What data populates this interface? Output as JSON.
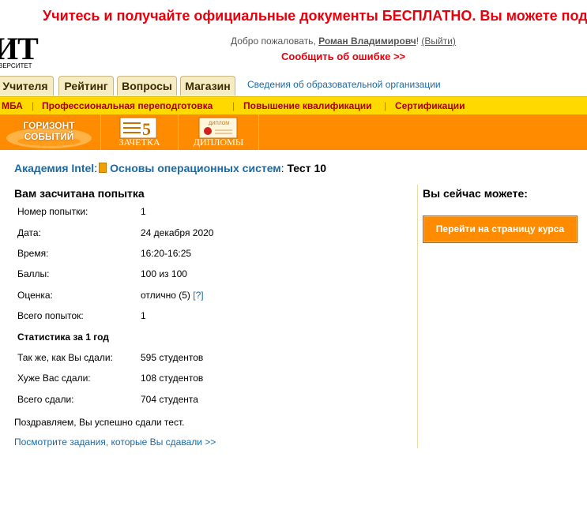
{
  "banner": {
    "text": "Учитесь и получайте официальные документы БЕСПЛАТНО. Вы можете поддержать н"
  },
  "logo": {
    "big": "ИТ",
    "small": "ВЕРСИТЕТ"
  },
  "header": {
    "welcome_prefix": "Добро пожаловать, ",
    "user_name": "Роман Владимировч",
    "after_name": "! ",
    "logout": "(Выйти)",
    "report_error": "Сообщить об ошибке >>",
    "org_info_link": "Сведения об образовательной организации"
  },
  "tabs": [
    "Учителя",
    "Рейтинг",
    "Вопросы",
    "Магазин"
  ],
  "yellow_nav": [
    "МБА",
    "Профессиональная переподготовка",
    "Повышение квалификации",
    "Сертификации"
  ],
  "orange_nav": {
    "horizon_line1": "ГОРИЗОНТ",
    "horizon_line2": "СОБЫТИЙ",
    "gradebook_icon_digit": "5",
    "gradebook": "ЗАЧЕТКА",
    "diploma_icon_text": "ДИПЛОМ",
    "diplomas": "ДИПЛОМЫ"
  },
  "breadcrumb": {
    "academy": "Академия Intel",
    "course": "Основы операционных систем",
    "current": "Тест 10"
  },
  "attempt": {
    "title": "Вам засчитана попытка",
    "rows": [
      {
        "label": "Номер попытки:",
        "value": "1"
      },
      {
        "label": "Дата:",
        "value": "24 декабря 2020"
      },
      {
        "label": "Время:",
        "value": "16:20-16:25"
      },
      {
        "label": "Баллы:",
        "value": "100 из 100"
      },
      {
        "label": "Оценка:",
        "value": "отлично (5)",
        "help": "[?]"
      },
      {
        "label": "Всего попыток:",
        "value": "1"
      }
    ],
    "stats_title": "Статистика за 1 год",
    "stats": [
      {
        "label": "Так же, как Вы сдали:",
        "value": "595 студентов"
      },
      {
        "label": "Хуже Вас сдали:",
        "value": "108 студентов"
      },
      {
        "label": "Всего сдали:",
        "value": "704 студента"
      }
    ],
    "congrats": "Поздравляем, Вы успешно сдали тест.",
    "tasks_link": "Посмотрите задания, которые Вы сдавали >>"
  },
  "sidebar": {
    "title": "Вы сейчас можете:",
    "course_button": "Перейти на страницу курса"
  },
  "colors": {
    "banner_red": "#e8000d",
    "nav_yellow": "#ffd900",
    "nav_orange": "#ff8c00",
    "link_blue": "#1a6aa5"
  }
}
